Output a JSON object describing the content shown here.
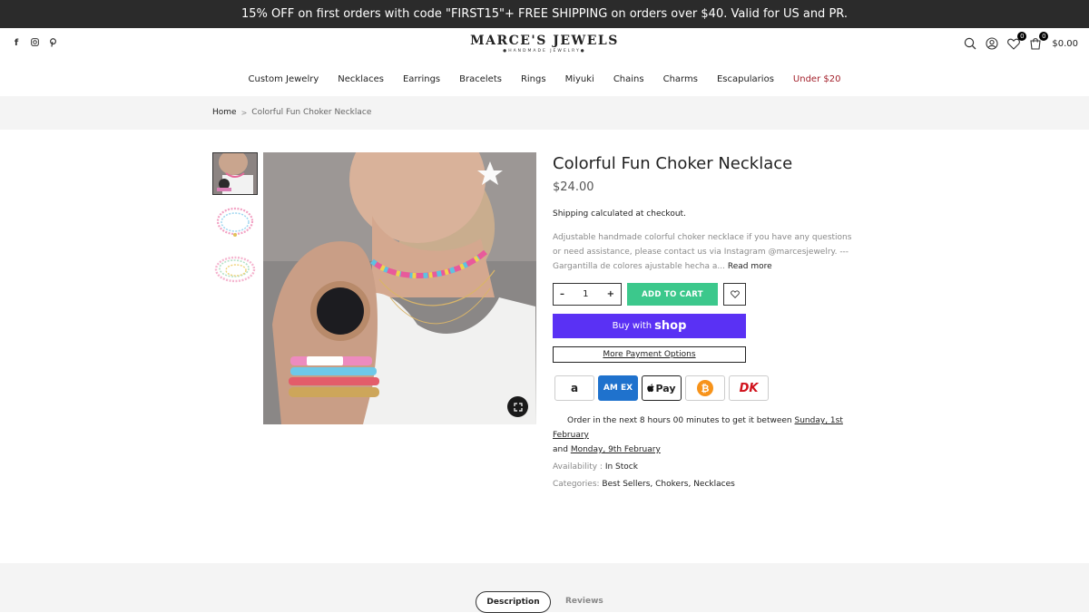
{
  "announcement": "15% OFF on first orders with code \"FIRST15\"+ FREE SHIPPING on orders over $40. Valid for US and PR.",
  "header": {
    "logo_name": "MARCE'S JEWELS",
    "logo_sub": "●HANDMADE JEWELRY●",
    "wishlist_count": "0",
    "cart_count": "0",
    "cart_total": "$0.00",
    "social_icons": [
      "facebook-icon",
      "instagram-icon",
      "pinterest-icon"
    ]
  },
  "nav": {
    "items": [
      "Custom Jewelry",
      "Necklaces",
      "Earrings",
      "Bracelets",
      "Rings",
      "Miyuki",
      "Chains",
      "Charms",
      "Escapularios",
      "Under $20"
    ]
  },
  "breadcrumb": {
    "home": "Home",
    "separator": ">",
    "current": "Colorful Fun Choker Necklace"
  },
  "product": {
    "title": "Colorful Fun Choker Necklace",
    "price": "$24.00",
    "shipping": "Shipping calculated at checkout.",
    "description": "Adjustable handmade colorful choker necklace if you have any questions or need assistance, please contact us via Instagram @marcesjewelry. --- Gargantilla de colores ajustable hecha a...",
    "read_more": "Read more",
    "quantity": "1",
    "qty_minus": "–",
    "qty_plus": "+",
    "add_to_cart": "ADD TO CART",
    "buy_with": "Buy with",
    "buy_brand": "shop",
    "more_payment": "More Payment Options",
    "delivery_prefix": "Order in the next 8 hours 00 minutes to get it between",
    "delivery_date1": "Sunday, 1st February",
    "delivery_and": "and",
    "delivery_date2": "Monday, 9th February",
    "availability_label": "Availability :",
    "availability_value": "In Stock",
    "categories_label": "Categories:",
    "categories": [
      "Best Sellers",
      "Chokers",
      "Necklaces"
    ],
    "category_separator": ","
  },
  "payment_icons": {
    "amazon": "a",
    "amex": "AM EX",
    "apple": "Pay",
    "bitcoin": "₿",
    "dankort": "DK"
  },
  "tabs": {
    "description": "Description",
    "reviews": "Reviews"
  },
  "colors": {
    "accent_green": "#3cc88c",
    "shop_purple": "#5a31f4",
    "sale_red": "#a3202b",
    "announce_bg": "#2b2b2b"
  }
}
